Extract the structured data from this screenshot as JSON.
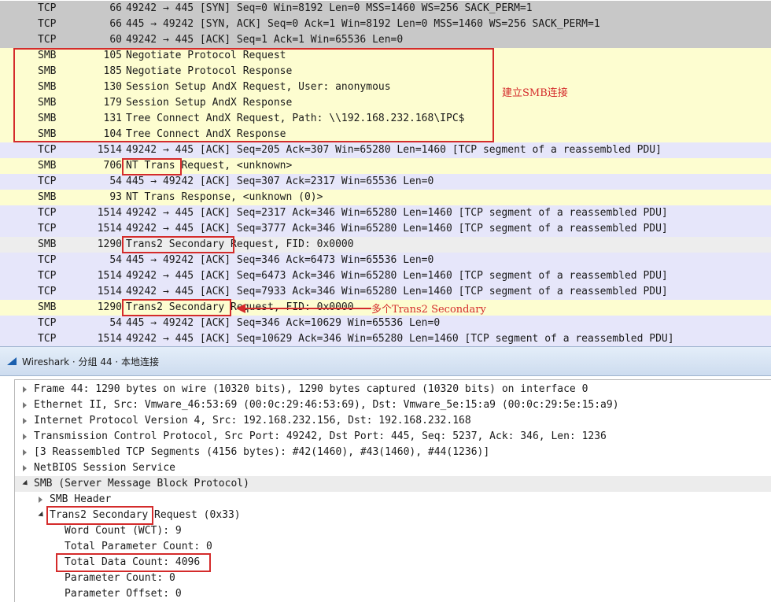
{
  "packets": [
    {
      "proto": "TCP",
      "len": "66",
      "info": "49242 → 445 [SYN] Seq=0 Win=8192 Len=0 MSS=1460 WS=256 SACK_PERM=1",
      "style": "gray"
    },
    {
      "proto": "TCP",
      "len": "66",
      "info": "445 → 49242 [SYN, ACK] Seq=0 Ack=1 Win=8192 Len=0 MSS=1460 WS=256 SACK_PERM=1",
      "style": "gray"
    },
    {
      "proto": "TCP",
      "len": "60",
      "info": "49242 → 445 [ACK] Seq=1 Ack=1 Win=65536 Len=0",
      "style": "gray"
    },
    {
      "proto": "SMB",
      "len": "105",
      "info": "Negotiate Protocol Request",
      "style": "smb"
    },
    {
      "proto": "SMB",
      "len": "185",
      "info": "Negotiate Protocol Response",
      "style": "smb"
    },
    {
      "proto": "SMB",
      "len": "130",
      "info": "Session Setup AndX Request, User: anonymous",
      "style": "smb"
    },
    {
      "proto": "SMB",
      "len": "179",
      "info": "Session Setup AndX Response",
      "style": "smb"
    },
    {
      "proto": "SMB",
      "len": "131",
      "info": "Tree Connect AndX Request, Path: \\\\192.168.232.168\\IPC$",
      "style": "smb"
    },
    {
      "proto": "SMB",
      "len": "104",
      "info": "Tree Connect AndX Response",
      "style": "smb"
    },
    {
      "proto": "TCP",
      "len": "1514",
      "info": "49242 → 445 [ACK] Seq=205 Ack=307 Win=65280 Len=1460 [TCP segment of a reassembled PDU]",
      "style": "tcp"
    },
    {
      "proto": "SMB",
      "len": "706",
      "info": "NT Trans Request, <unknown>",
      "style": "smb"
    },
    {
      "proto": "TCP",
      "len": "54",
      "info": "445 → 49242 [ACK] Seq=307 Ack=2317 Win=65536 Len=0",
      "style": "tcp"
    },
    {
      "proto": "SMB",
      "len": "93",
      "info": "NT Trans Response, <unknown (0)>",
      "style": "smb"
    },
    {
      "proto": "TCP",
      "len": "1514",
      "info": "49242 → 445 [ACK] Seq=2317 Ack=346 Win=65280 Len=1460 [TCP segment of a reassembled PDU]",
      "style": "tcp"
    },
    {
      "proto": "TCP",
      "len": "1514",
      "info": "49242 → 445 [ACK] Seq=3777 Ack=346 Win=65280 Len=1460 [TCP segment of a reassembled PDU]",
      "style": "tcp"
    },
    {
      "proto": "SMB",
      "len": "1290",
      "info": "Trans2 Secondary Request, FID: 0x0000",
      "style": "sel"
    },
    {
      "proto": "TCP",
      "len": "54",
      "info": "445 → 49242 [ACK] Seq=346 Ack=6473 Win=65536 Len=0",
      "style": "tcp"
    },
    {
      "proto": "TCP",
      "len": "1514",
      "info": "49242 → 445 [ACK] Seq=6473 Ack=346 Win=65280 Len=1460 [TCP segment of a reassembled PDU]",
      "style": "tcp"
    },
    {
      "proto": "TCP",
      "len": "1514",
      "info": "49242 → 445 [ACK] Seq=7933 Ack=346 Win=65280 Len=1460 [TCP segment of a reassembled PDU]",
      "style": "tcp"
    },
    {
      "proto": "SMB",
      "len": "1290",
      "info": "Trans2 Secondary Request, FID: 0x0000",
      "style": "smb"
    },
    {
      "proto": "TCP",
      "len": "54",
      "info": "445 → 49242 [ACK] Seq=346 Ack=10629 Win=65536 Len=0",
      "style": "tcp"
    },
    {
      "proto": "TCP",
      "len": "1514",
      "info": "49242 → 445 [ACK] Seq=10629 Ack=346 Win=65280 Len=1460 [TCP segment of a reassembled PDU]",
      "style": "tcp"
    }
  ],
  "annotations": {
    "smb_connect": "建立SMB连接",
    "multi_trans2": "多个Trans2 Secondary"
  },
  "window": {
    "title": "Wireshark · 分组 44 · 本地连接"
  },
  "details": [
    {
      "text": "Frame 44: 1290 bytes on wire (10320 bits), 1290 bytes captured (10320 bits) on interface 0",
      "toggle": "closed",
      "hl": false
    },
    {
      "text": "Ethernet II, Src: Vmware_46:53:69 (00:0c:29:46:53:69), Dst: Vmware_5e:15:a9 (00:0c:29:5e:15:a9)",
      "toggle": "closed",
      "hl": false
    },
    {
      "text": "Internet Protocol Version 4, Src: 192.168.232.156, Dst: 192.168.232.168",
      "toggle": "closed",
      "hl": false
    },
    {
      "text": "Transmission Control Protocol, Src Port: 49242, Dst Port: 445, Seq: 5237, Ack: 346, Len: 1236",
      "toggle": "closed",
      "hl": false
    },
    {
      "text": "[3 Reassembled TCP Segments (4156 bytes): #42(1460), #43(1460), #44(1236)]",
      "toggle": "closed",
      "hl": false
    },
    {
      "text": "NetBIOS Session Service",
      "toggle": "closed",
      "hl": false
    },
    {
      "text": "SMB (Server Message Block Protocol)",
      "toggle": "open",
      "hl": true
    },
    {
      "text": "SMB Header",
      "toggle": "closed",
      "hl": false
    },
    {
      "text": "Trans2 Secondary Request (0x33)",
      "toggle": "open",
      "hl": false
    },
    {
      "text": "Word Count (WCT): 9",
      "toggle": "none",
      "hl": false
    },
    {
      "text": "Total Parameter Count: 0",
      "toggle": "none",
      "hl": false
    },
    {
      "text": "Total Data Count: 4096",
      "toggle": "none",
      "hl": false
    },
    {
      "text": "Parameter Count: 0",
      "toggle": "none",
      "hl": false
    },
    {
      "text": "Parameter Offset: 0",
      "toggle": "none",
      "hl": false
    }
  ],
  "colors": {
    "tcp_row": "#e6e6fa",
    "smb_row": "#fdfdd0",
    "gray_row": "#c8c8c8",
    "annotation": "#d42b2b"
  }
}
